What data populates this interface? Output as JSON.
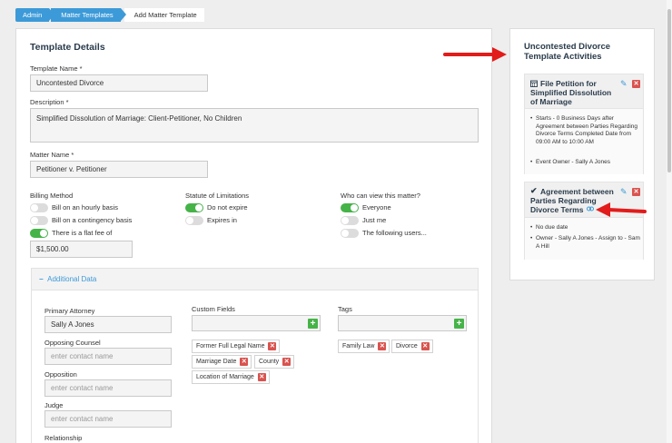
{
  "breadcrumbs": [
    "Admin",
    "Matter Templates",
    "Add Matter Template"
  ],
  "details": {
    "heading": "Template Details",
    "template_name_label": "Template Name *",
    "template_name_value": "Uncontested Divorce",
    "description_label": "Description *",
    "description_value": "Simplified Dissolution of Marriage:  Client-Petitioner, No Children",
    "matter_name_label": "Matter Name *",
    "matter_name_value": "Petitioner v. Petitioner"
  },
  "billing": {
    "label": "Billing Method",
    "options": [
      "Bill on an hourly basis",
      "Bill on a contingency basis",
      "There is a flat fee of"
    ],
    "selected": 2,
    "fee_value": "$1,500.00"
  },
  "statute": {
    "label": "Statute of Limitations",
    "options": [
      "Do not expire",
      "Expires in"
    ],
    "selected": 0
  },
  "visibility": {
    "label": "Who can view this matter?",
    "options": [
      "Everyone",
      "Just me",
      "The following users..."
    ],
    "selected": 0
  },
  "additional": {
    "toggle_label": "Additional Data",
    "toggle_symbol": "−",
    "primary_attorney_label": "Primary Attorney",
    "primary_attorney_value": "Sally A Jones",
    "opposing_counsel_label": "Opposing Counsel",
    "opposing_counsel_placeholder": "enter contact name",
    "opposition_label": "Opposition",
    "opposition_placeholder": "enter contact name",
    "judge_label": "Judge",
    "judge_placeholder": "enter contact name",
    "relationship_label": "Relationship",
    "custom_fields_label": "Custom Fields",
    "custom_fields": [
      "Former Full Legal Name",
      "Marriage Date",
      "County",
      "Location of Marriage"
    ],
    "tags_label": "Tags",
    "tags": [
      "Family Law",
      "Divorce"
    ]
  },
  "sidebar": {
    "heading_line1": "Uncontested Divorce",
    "heading_line2": "Template Activities",
    "activities": [
      {
        "title": "File Petition for Simplified Dissolution of Marriage",
        "icon": "calendar-icon",
        "bullets": [
          "Starts - 0 Business Days after Agreement between Parties Regarding Divorce Terms Completed Date from 09:00 AM to 10:00 AM",
          "Event Owner - Sally A Jones"
        ]
      },
      {
        "title": "Agreement between Parties Regarding Divorce Terms",
        "icon": "checkmark-icon",
        "bullets": [
          "No due date",
          "Owner - Sally A Jones - Assign to - Sam A Hill"
        ]
      }
    ]
  },
  "colors": {
    "accent_blue": "#3c9ad8",
    "toggle_green": "#46b348",
    "delete_red": "#d9534f",
    "arrow_red": "#e21b1b"
  }
}
